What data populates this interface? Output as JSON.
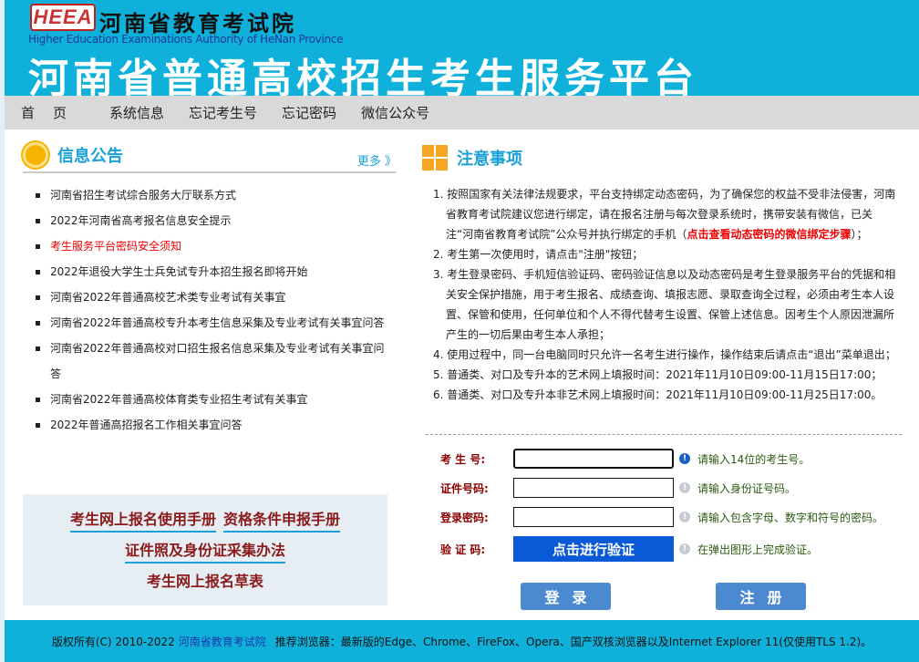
{
  "header": {
    "logo_text": "HEEA",
    "org_cn": "河南省教育考试院",
    "org_en": "Higher Education Examinations Authority of HeNan Province",
    "title": "河南省普通高校招生考生服务平台"
  },
  "nav": [
    "首页",
    "系统信息",
    "忘记考生号",
    "忘记密码",
    "微信公众号"
  ],
  "news": {
    "title": "信息公告",
    "more": "更多 》",
    "items": [
      {
        "text": "河南省招生考试综合服务大厅联系方式",
        "red": false
      },
      {
        "text": "2022年河南省高考报名信息安全提示",
        "red": false
      },
      {
        "text": "考生服务平台密码安全须知",
        "red": true
      },
      {
        "text": "2022年退役大学生士兵免试专升本招生报名即将开始",
        "red": false
      },
      {
        "text": "河南省2022年普通高校艺术类专业考试有关事宜",
        "red": false
      },
      {
        "text": "河南省2022年普通高校专升本考生信息采集及专业考试有关事宜问答",
        "red": false
      },
      {
        "text": "河南省2022年普通高校对口招生报名信息采集及专业考试有关事宜问答",
        "red": false
      },
      {
        "text": "河南省2022年普通高校体育类专业招生考试有关事宜",
        "red": false
      },
      {
        "text": "2022年普通高招报名工作相关事宜问答",
        "red": false
      }
    ]
  },
  "manuals": [
    "考生网上报名使用手册",
    "资格条件申报手册",
    "证件照及身份证采集办法",
    "考生网上报名草表"
  ],
  "notes": {
    "title": "注意事项",
    "n1_prefix": "1. 按照国家有关法律法规要求，平台支持绑定动态密码，为了确保您的权益不受非法侵害，河南省教育考试院建议您进行绑定，请在报名注册与每次登录系统时，携带安装有微信，已关注“河南省教育考试院”公众号并执行绑定的手机（",
    "n1_link": "点击查看动态密码的微信绑定步骤",
    "n1_suffix": "）；",
    "items": [
      "2. 考生第一次使用时，请点击\"注册\"按钮；",
      "3. 考生登录密码、手机短信验证码、密码验证信息以及动态密码是考生登录服务平台的凭据和相关安全保护措施，用于考生报名、成绩查询、填报志愿、录取查询全过程，必须由考生本人设置、保管和使用，任何单位和个人不得代替考生设置、保管上述信息。因考生个人原因泄漏所产生的一切后果由考生本人承担；",
      "4. 使用过程中，同一台电脑同时只允许一名考生进行操作，操作结束后请点击“退出”菜单退出；",
      "5. 普通类、对口及专升本的艺术网上填报时间：2021年11月10日09:00-11月15日17:00；",
      "6. 普通类、对口及专升本非艺术网上填报时间：2021年11月10日09:00-11月25日17:00。"
    ]
  },
  "form": {
    "exam_no": {
      "label": "考 生 号:",
      "value": "",
      "hint": "请输入14位的考生号。"
    },
    "id_no": {
      "label": "证件号码:",
      "value": "",
      "hint": "请输入身份证号码。"
    },
    "password": {
      "label": "登录密码:",
      "value": "",
      "hint": "请输入包含字母、数字和符号的密码。"
    },
    "captcha": {
      "label": "验 证 码:",
      "button": "点击进行验证",
      "hint": "在弹出图形上完成验证。"
    },
    "login": "登录",
    "register": "注册"
  },
  "footer": {
    "copyright": "版权所有(C) 2010-2022",
    "org_link": "河南省教育考试院",
    "browsers": "推荐浏览器：最新版的Edge、Chrome、FireFox、Opera、国产双核浏览器以及Internet Explorer 11(仅使用TLS 1.2)。"
  },
  "colors": {
    "header": "#0fb0da",
    "nav": "#d9d9d9",
    "accent": "#1ba0d8",
    "button": "#4b8ad0",
    "captcha": "#0a5ad8",
    "warning": "#e00000"
  }
}
